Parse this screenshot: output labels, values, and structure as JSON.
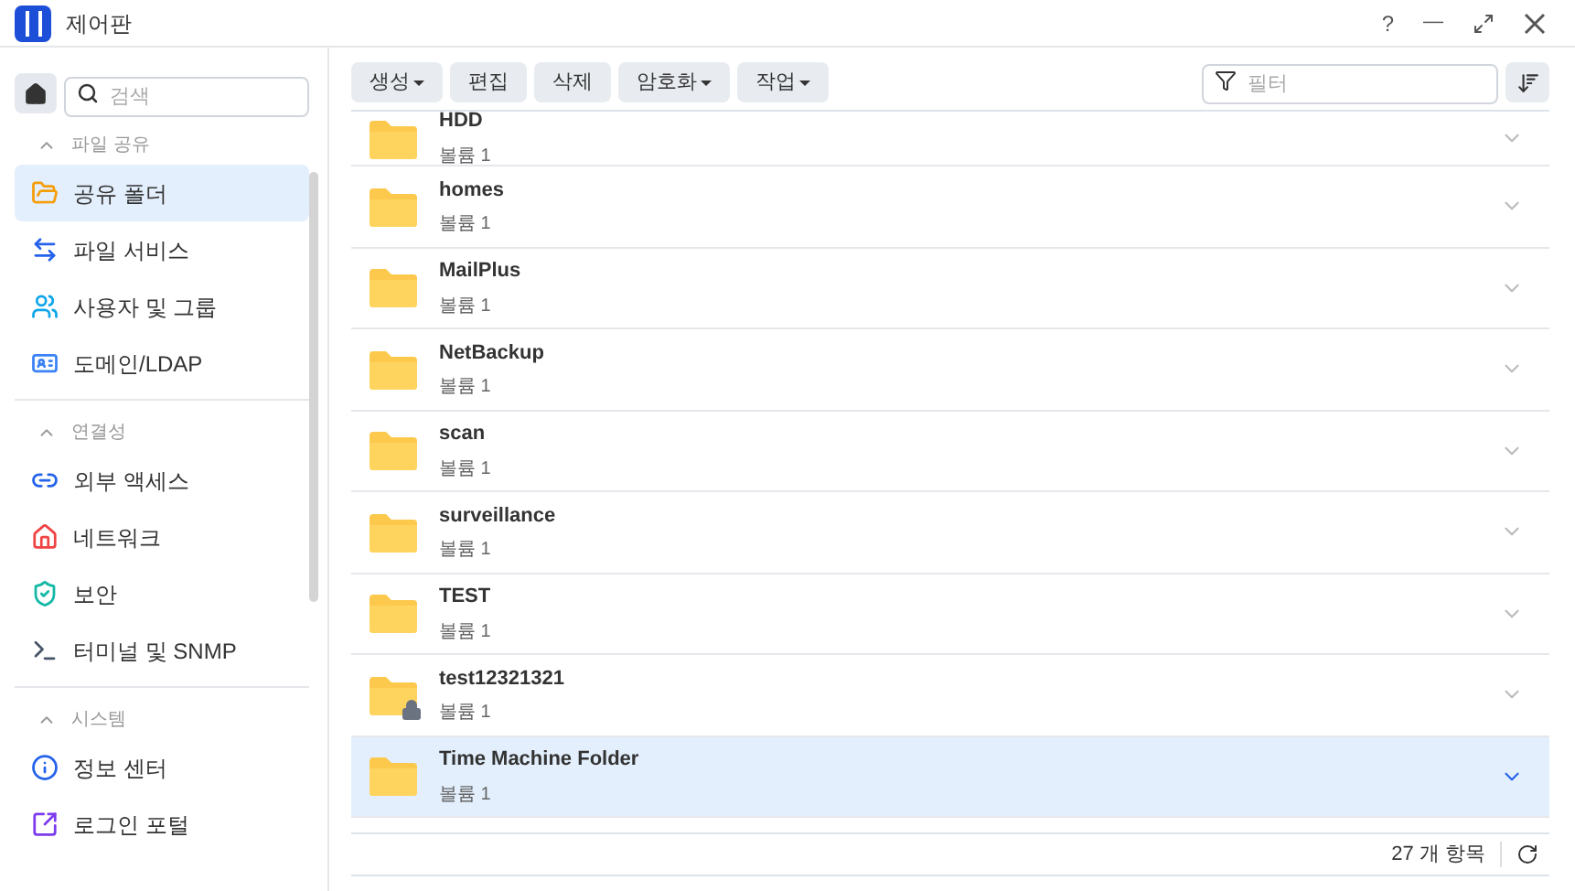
{
  "window": {
    "title": "제어판",
    "controls": [
      "?",
      "—"
    ]
  },
  "sidebar": {
    "search_placeholder": "검색",
    "sections": [
      {
        "title": "파일 공유",
        "expanded": true,
        "items": [
          {
            "label": "공유 폴더",
            "selected": true
          },
          {
            "label": "파일 서비스",
            "selected": false
          },
          {
            "label": "사용자 및 그룹",
            "selected": false
          },
          {
            "label": "도메인/LDAP",
            "selected": false
          }
        ]
      },
      {
        "title": "연결성",
        "expanded": true,
        "items": [
          {
            "label": "외부 액세스",
            "selected": false
          },
          {
            "label": "네트워크",
            "selected": false
          },
          {
            "label": "보안",
            "selected": false
          },
          {
            "label": "터미널 및 SNMP",
            "selected": false
          }
        ]
      },
      {
        "title": "시스템",
        "expanded": true,
        "items": [
          {
            "label": "정보 센터",
            "selected": false
          },
          {
            "label": "로그인 포털",
            "selected": false
          }
        ]
      }
    ]
  },
  "toolbar": {
    "buttons": [
      {
        "label": "생성",
        "dropdown": true
      },
      {
        "label": "편집",
        "dropdown": false
      },
      {
        "label": "삭제",
        "dropdown": false
      },
      {
        "label": "암호화",
        "dropdown": true
      },
      {
        "label": "작업",
        "dropdown": true
      }
    ],
    "filter_placeholder": "필터"
  },
  "folders": [
    {
      "name": "HDD",
      "detail": "볼륨 1",
      "locked": false,
      "selected": false
    },
    {
      "name": "homes",
      "detail": "볼륨 1",
      "locked": false,
      "selected": false
    },
    {
      "name": "MailPlus",
      "detail": "볼륨 1",
      "locked": false,
      "selected": false
    },
    {
      "name": "NetBackup",
      "detail": "볼륨 1",
      "locked": false,
      "selected": false
    },
    {
      "name": "scan",
      "detail": "볼륨 1",
      "locked": false,
      "selected": false
    },
    {
      "name": "surveillance",
      "detail": "볼륨 1",
      "locked": false,
      "selected": false
    },
    {
      "name": "TEST",
      "detail": "볼륨 1",
      "locked": false,
      "selected": false
    },
    {
      "name": "test12321321",
      "detail": "볼륨 1",
      "locked": true,
      "selected": false
    },
    {
      "name": "Time Machine Folder",
      "detail": "볼륨 1",
      "locked": false,
      "selected": true
    }
  ],
  "status_bar": {
    "count": "27 개 항목"
  }
}
